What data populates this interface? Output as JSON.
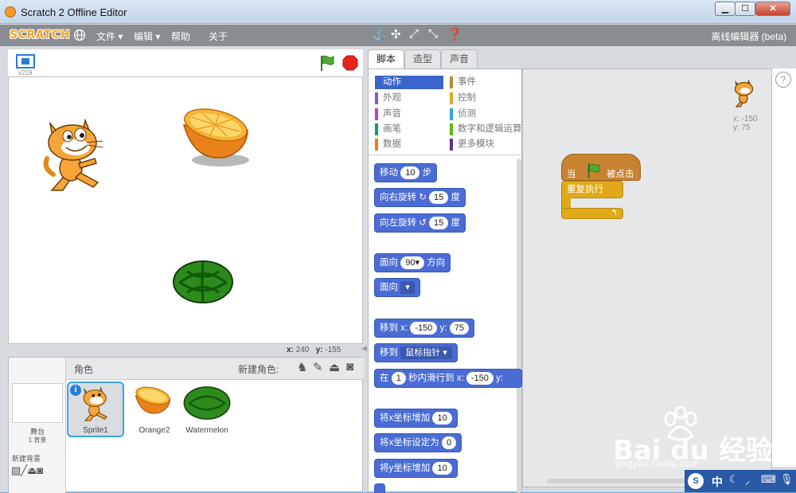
{
  "window": {
    "title": "Scratch 2 Offline Editor",
    "min": "▁",
    "max": "☐",
    "close": "✕"
  },
  "menubar": {
    "logo": "SCRATCH",
    "file": "文件 ▾",
    "edit": "编辑 ▾",
    "help": "帮助",
    "about": "关于",
    "edition": "离线编辑器 (beta)"
  },
  "stage": {
    "version": "v219",
    "mouse_x_label": "x:",
    "mouse_x": "240",
    "mouse_y_label": "y:",
    "mouse_y": "-155"
  },
  "sprites_pane": {
    "title": "角色",
    "new_sprite": "新建角色:",
    "stage_label": "舞台",
    "backdrop_count": "1 背景",
    "new_backdrop": "新建背景",
    "sprites": [
      {
        "name": "Sprite1"
      },
      {
        "name": "Orange2"
      },
      {
        "name": "Watermelon"
      }
    ]
  },
  "tabs": {
    "scripts": "脚本",
    "costumes": "造型",
    "sounds": "声音"
  },
  "categories": {
    "left": [
      {
        "label": "动作",
        "color": "#4a6cd4"
      },
      {
        "label": "外观",
        "color": "#8a55d7"
      },
      {
        "label": "声音",
        "color": "#bb42c3"
      },
      {
        "label": "画笔",
        "color": "#0e9a6c"
      },
      {
        "label": "数据",
        "color": "#ee7d16"
      }
    ],
    "right": [
      {
        "label": "事件",
        "color": "#c88330"
      },
      {
        "label": "控制",
        "color": "#e1a91a"
      },
      {
        "label": "侦测",
        "color": "#2ca5e2"
      },
      {
        "label": "数字和逻辑运算",
        "color": "#5cb712"
      },
      {
        "label": "更多模块",
        "color": "#632d99"
      }
    ]
  },
  "blocks": {
    "move": {
      "pre": "移动",
      "val": "10",
      "post": "步"
    },
    "turn_right": {
      "pre": "向右旋转",
      "val": "15",
      "post": "度"
    },
    "turn_left": {
      "pre": "向左旋转",
      "val": "15",
      "post": "度"
    },
    "point_dir": {
      "pre": "面向",
      "val": "90▾",
      "post": "方向"
    },
    "point_towards": {
      "pre": "面向"
    },
    "goto_xy": {
      "pre": "移到 x:",
      "x": "-150",
      "ylabel": "y:",
      "y": "75"
    },
    "goto": {
      "pre": "移到",
      "val": "鼠标指针"
    },
    "glide": {
      "pre": "在",
      "val": "1",
      "mid": "秒内滑行到 x:",
      "x": "-150",
      "ylabel": "y:"
    },
    "change_x": {
      "pre": "将x坐标增加",
      "val": "10"
    },
    "set_x": {
      "pre": "将x坐标设定为",
      "val": "0"
    },
    "change_y": {
      "pre": "将y坐标增加",
      "val": "10"
    }
  },
  "script": {
    "hat_pre": "当",
    "hat_post": "被点击",
    "forever": "重复执行"
  },
  "sprite_info": {
    "x": "x: -150",
    "y": "y: 75"
  },
  "watermark": {
    "brand": "Bai du 经验",
    "url": "jingyan.baidu.com"
  },
  "tray": {
    "ime": "中"
  },
  "colors": {
    "motion": "#4a6cd4",
    "events": "#c88330",
    "control": "#e1a91a",
    "menubar": "#898c91"
  }
}
